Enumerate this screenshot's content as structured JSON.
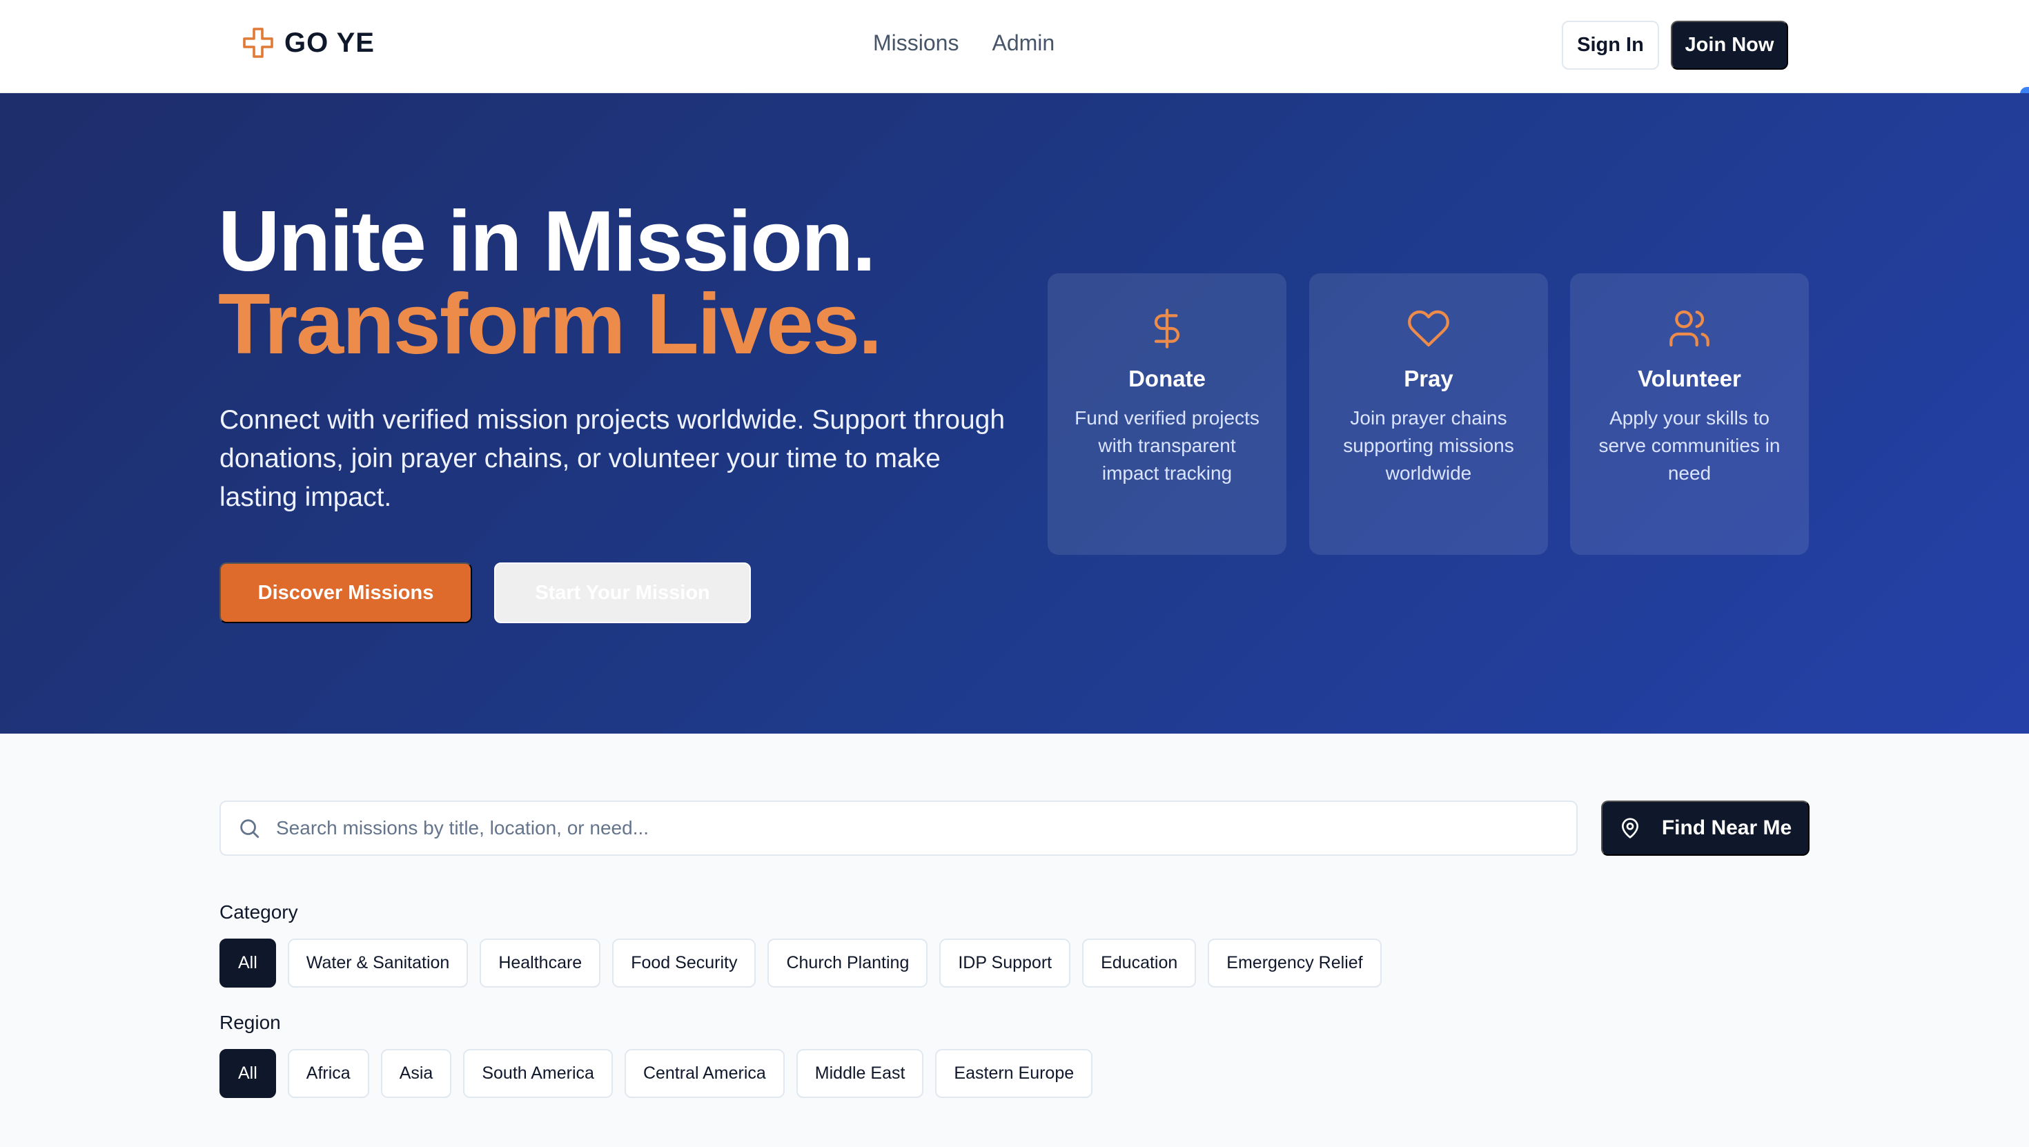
{
  "brand": {
    "name": "GO YE",
    "accent": "#ed8b4a",
    "dark": "#0f172a"
  },
  "nav": {
    "links": [
      "Missions",
      "Admin"
    ],
    "sign_in": "Sign In",
    "join_now": "Join Now"
  },
  "hero": {
    "title_line1": "Unite in Mission.",
    "title_line2": "Transform Lives.",
    "description": "Connect with verified mission projects worldwide. Support through donations, join prayer chains, or volunteer your time to make lasting impact.",
    "primary_button": "Discover Missions",
    "secondary_button": "Start Your Mission",
    "cards": [
      {
        "icon": "dollar-icon",
        "title": "Donate",
        "desc": "Fund verified projects with transparent impact tracking"
      },
      {
        "icon": "heart-icon",
        "title": "Pray",
        "desc": "Join prayer chains supporting missions worldwide"
      },
      {
        "icon": "users-icon",
        "title": "Volunteer",
        "desc": "Apply your skills to serve communities in need"
      }
    ]
  },
  "search": {
    "placeholder": "Search missions by title, location, or need...",
    "value": "",
    "find_near_label": "Find Near Me"
  },
  "filters": {
    "category_label": "Category",
    "categories": [
      "All",
      "Water & Sanitation",
      "Healthcare",
      "Food Security",
      "Church Planting",
      "IDP Support",
      "Education",
      "Emergency Relief"
    ],
    "category_selected": "All",
    "region_label": "Region",
    "regions": [
      "All",
      "Africa",
      "Asia",
      "South America",
      "Central America",
      "Middle East",
      "Eastern Europe"
    ],
    "region_selected": "All"
  }
}
